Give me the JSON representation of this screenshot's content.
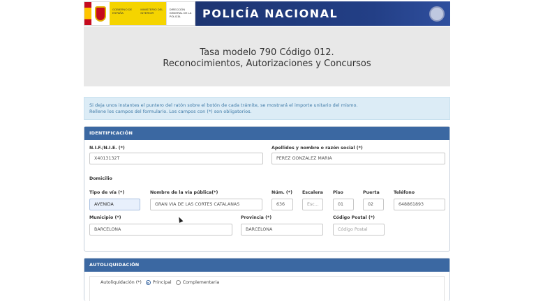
{
  "banner": {
    "gov_line1": "GOBIERNO DE ESPAÑA",
    "gov_line2": "MINISTERIO DEL INTERIOR",
    "gov_line3": "DIRECCIÓN GENERAL DE LA POLICÍA",
    "brand": "POLICÍA NACIONAL"
  },
  "title": {
    "line1": "Tasa modelo 790 Código 012.",
    "line2": "Reconocimientos, Autorizaciones y Concursos"
  },
  "info": {
    "line1": "Si deja unos instantes el puntero del ratón sobre el botón de cada trámite, se mostrará el importe unitario del mismo.",
    "line2": "Rellene los campos del formulario. Los campos con (*) son obligatorios."
  },
  "identificacion": {
    "header": "IDENTIFICACIÓN",
    "nif_label": "N.I.F./N.I.E. (*)",
    "nif_value": "X4013132T",
    "nombre_label": "Apellidos y nombre o razón social (*)",
    "nombre_value": "PEREZ GONZALEZ MARIA",
    "domicilio_label": "Domicilio",
    "tipo_via_label": "Tipo de vía (*)",
    "tipo_via_value": "AVENIDA",
    "nombre_via_label": "Nombre de la vía pública(*)",
    "nombre_via_value": "GRAN VIA DE LAS CORTES CATALANAS",
    "num_label": "Núm. (*)",
    "num_value": "636",
    "escalera_label": "Escalera",
    "escalera_placeholder": "Esc...",
    "piso_label": "Piso",
    "piso_value": "01",
    "puerta_label": "Puerta",
    "puerta_value": "02",
    "telefono_label": "Teléfono",
    "telefono_value": "648861893",
    "municipio_label": "Municipio (*)",
    "municipio_value": "BARCELONA",
    "provincia_label": "Provincia (*)",
    "provincia_value": "BARCELONA",
    "cp_label": "Código Postal (*)",
    "cp_placeholder": "Código Postal"
  },
  "autoliquidacion": {
    "header": "AUTOLIQUIDACIÓN",
    "label": "Autoliquidación (*)",
    "option1": "Principal",
    "option2": "Complementaria",
    "selected": "Principal"
  }
}
